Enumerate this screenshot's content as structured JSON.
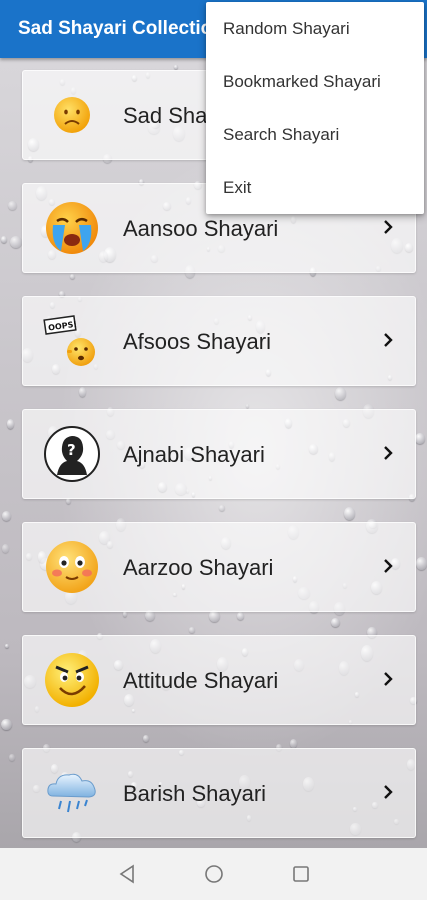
{
  "app": {
    "title": "Sad Shayari Collection"
  },
  "overflow_menu": {
    "items": [
      {
        "label": "Random Shayari"
      },
      {
        "label": "Bookmarked Shayari"
      },
      {
        "label": "Search Shayari"
      },
      {
        "label": "Exit"
      }
    ]
  },
  "categories": [
    {
      "label": "Sad Shayari",
      "icon": "sad-face-icon"
    },
    {
      "label": "Aansoo Shayari",
      "icon": "crying-face-icon"
    },
    {
      "label": "Afsoos Shayari",
      "icon": "oops-face-icon"
    },
    {
      "label": "Ajnabi Shayari",
      "icon": "stranger-silhouette-icon"
    },
    {
      "label": "Aarzoo Shayari",
      "icon": "blushing-face-icon"
    },
    {
      "label": "Attitude Shayari",
      "icon": "attitude-face-icon"
    },
    {
      "label": "Barish Shayari",
      "icon": "rain-cloud-icon"
    }
  ],
  "colors": {
    "appbar": "#1a73c9",
    "menu_bg": "#ffffff",
    "card_bg": "rgba(255,255,255,0.62)"
  },
  "navigation": {
    "back": "back-triangle-icon",
    "home": "home-circle-icon",
    "recents": "recents-square-icon"
  }
}
